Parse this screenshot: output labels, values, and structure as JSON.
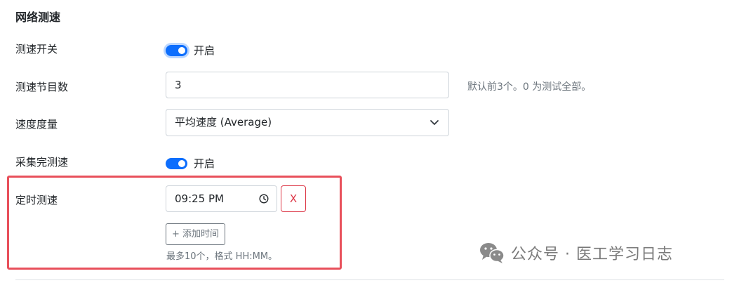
{
  "section": {
    "title": "网络测速"
  },
  "speedtest_switch": {
    "label": "测速开关",
    "state_text": "开启",
    "enabled": true
  },
  "node_count": {
    "label": "测速节目数",
    "value": "3",
    "help": "默认前3个。0 为测试全部。"
  },
  "speed_metric": {
    "label": "速度度量",
    "selected": "平均速度 (Average)"
  },
  "collect_then_test": {
    "label": "采集完测速",
    "state_text": "开启",
    "enabled": true
  },
  "scheduled_test": {
    "label": "定时测速",
    "times": [
      "09:25 PM"
    ],
    "remove_label": "X",
    "add_label": "+ 添加时间",
    "help": "最多10个，格式 HH:MM。"
  },
  "watermark": {
    "text": "公众号 · 医工学习日志"
  },
  "colors": {
    "primary": "#0d6efd",
    "danger": "#dc3545",
    "highlight": "#e8505b",
    "muted": "#6c757d",
    "border": "#ced4da"
  },
  "icons": {
    "chevron": "chevron-down-icon",
    "clock": "clock-icon",
    "watermark": "wechat-icon"
  }
}
